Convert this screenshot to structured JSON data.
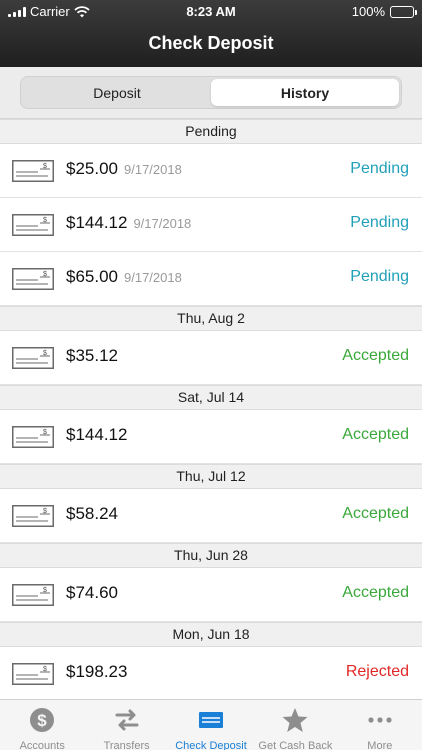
{
  "status_bar": {
    "carrier": "Carrier",
    "time": "8:23 AM",
    "battery": "100%"
  },
  "nav": {
    "title": "Check Deposit"
  },
  "segments": {
    "deposit": "Deposit",
    "history": "History",
    "selected": "History"
  },
  "colors": {
    "pending": "#21a0b8",
    "accepted": "#3aa83a",
    "rejected": "#e02828",
    "active_tab": "#1a7fd6"
  },
  "sections": [
    {
      "header": "Pending",
      "items": [
        {
          "amount": "$25.00",
          "date": "9/17/2018",
          "status": "Pending"
        },
        {
          "amount": "$144.12",
          "date": "9/17/2018",
          "status": "Pending"
        },
        {
          "amount": "$65.00",
          "date": "9/17/2018",
          "status": "Pending"
        }
      ]
    },
    {
      "header": "Thu, Aug 2",
      "items": [
        {
          "amount": "$35.12",
          "date": "",
          "status": "Accepted"
        }
      ]
    },
    {
      "header": "Sat, Jul 14",
      "items": [
        {
          "amount": "$144.12",
          "date": "",
          "status": "Accepted"
        }
      ]
    },
    {
      "header": "Thu, Jul 12",
      "items": [
        {
          "amount": "$58.24",
          "date": "",
          "status": "Accepted"
        }
      ]
    },
    {
      "header": "Thu, Jun 28",
      "items": [
        {
          "amount": "$74.60",
          "date": "",
          "status": "Accepted"
        }
      ]
    },
    {
      "header": "Mon, Jun 18",
      "items": [
        {
          "amount": "$198.23",
          "date": "",
          "status": "Rejected"
        }
      ]
    }
  ],
  "tabs": [
    {
      "label": "Accounts",
      "icon": "dollar-coin-icon"
    },
    {
      "label": "Transfers",
      "icon": "transfer-arrows-icon"
    },
    {
      "label": "Check Deposit",
      "icon": "check-card-icon",
      "active": true
    },
    {
      "label": "Get Cash Back",
      "icon": "star-icon"
    },
    {
      "label": "More",
      "icon": "more-dots-icon"
    }
  ]
}
